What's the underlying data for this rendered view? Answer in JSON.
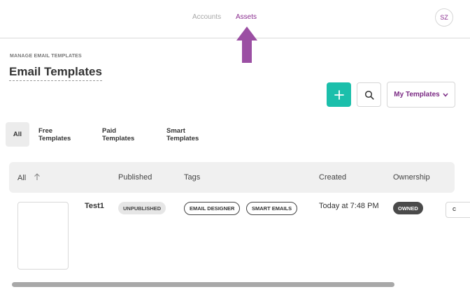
{
  "nav": {
    "accounts": "Accounts",
    "assets": "Assets",
    "avatar_initials": "SZ"
  },
  "header": {
    "overline": "MANAGE EMAIL TEMPLATES",
    "title": "Email Templates"
  },
  "toolbar": {
    "add_icon": "plus-icon",
    "search_icon": "search-icon",
    "my_templates_label": "My Templates",
    "dropdown_icon": "chevron-down-icon"
  },
  "tabs": [
    {
      "label": "All",
      "active": true
    },
    {
      "label": "Free Templates",
      "active": false
    },
    {
      "label": "Paid Templates",
      "active": false
    },
    {
      "label": "Smart Templates",
      "active": false
    }
  ],
  "table": {
    "columns": [
      "All",
      "Published",
      "Tags",
      "Created",
      "Ownership"
    ],
    "rows": [
      {
        "name": "Test1",
        "published": "UNPUBLISHED",
        "tags": [
          "EMAIL DESIGNER",
          "SMART EMAILS"
        ],
        "created": "Today at 7:48 PM",
        "ownership": "OWNED",
        "action": "C"
      }
    ]
  },
  "colors": {
    "accent": "#8a2d8f",
    "add_button": "#1bbfab",
    "annotation_arrow": "#9b4fa3"
  }
}
